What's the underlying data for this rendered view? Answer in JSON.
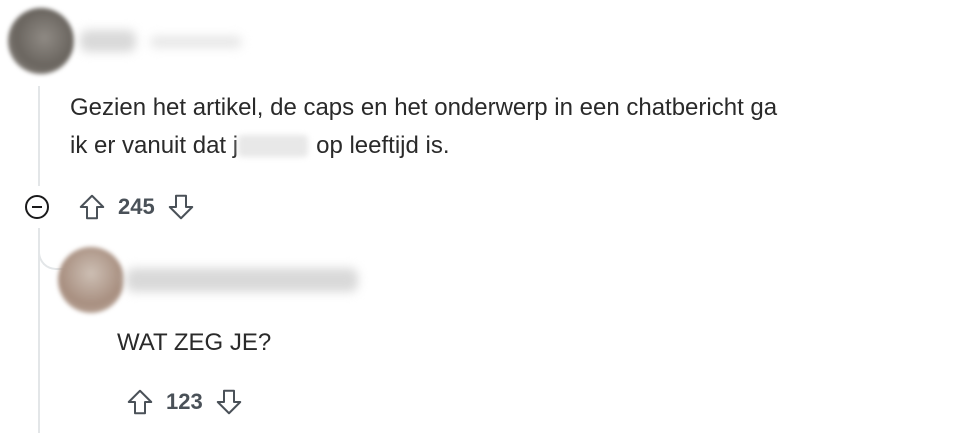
{
  "comment": {
    "text_line1": "Gezien het artikel, de caps en het onderwerp in een chatbericht ga",
    "text_line2_start": "ik er vanuit dat j",
    "text_line2_end": "op leeftijd is.",
    "score": "245",
    "icons": {
      "upvote": "arrow-up-outline",
      "downvote": "arrow-down-outline",
      "collapse": "circle-minus"
    }
  },
  "reply": {
    "text": "WAT ZEG JE?",
    "score": "123",
    "icons": {
      "upvote": "arrow-up-outline",
      "downvote": "arrow-down-outline"
    }
  },
  "colors": {
    "thread_line": "#e3e6e8",
    "score_text": "#4a5158",
    "body_text": "#2a2a2a"
  }
}
